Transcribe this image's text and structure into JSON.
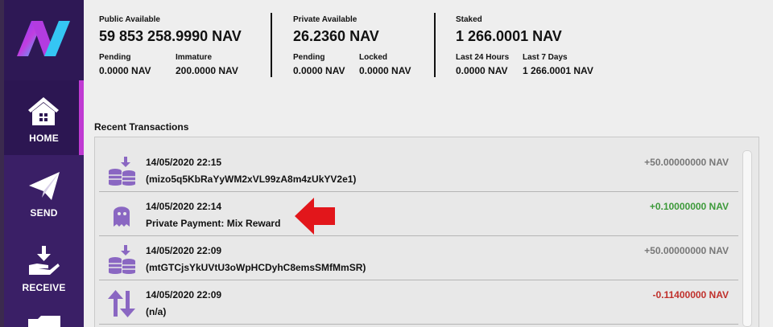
{
  "sidebar": {
    "items": [
      {
        "label": "HOME",
        "icon": "home-icon",
        "active": true
      },
      {
        "label": "SEND",
        "icon": "send-icon",
        "active": false
      },
      {
        "label": "RECEIVE",
        "icon": "receive-icon",
        "active": false
      }
    ]
  },
  "balances": {
    "public": {
      "title": "Public Available",
      "value": "59 853 258.9990 NAV",
      "pending_label": "Pending",
      "pending_value": "0.0000 NAV",
      "immature_label": "Immature",
      "immature_value": "200.0000 NAV"
    },
    "private": {
      "title": "Private Available",
      "value": "26.2360 NAV",
      "pending_label": "Pending",
      "pending_value": "0.0000 NAV",
      "locked_label": "Locked",
      "locked_value": "0.0000 NAV"
    },
    "staked": {
      "title": "Staked",
      "value": "1 266.0001 NAV",
      "last24_label": "Last 24 Hours",
      "last24_value": "0.0000 NAV",
      "last7_label": "Last 7 Days",
      "last7_value": "1 266.0001 NAV"
    }
  },
  "transactions": {
    "title": "Recent Transactions",
    "rows": [
      {
        "date": "14/05/2020 22:15",
        "desc": "(mizo5q5KbRaYyWM2xVL99zA8m4zUkYV2e1)",
        "amount": "+50.00000000 NAV",
        "icon": "stake-coins-icon"
      },
      {
        "date": "14/05/2020 22:14",
        "desc": "Private Payment: Mix Reward",
        "amount": "+0.10000000 NAV",
        "icon": "ghost-icon"
      },
      {
        "date": "14/05/2020 22:09",
        "desc": "(mtGTCjsYkUVtU3oWpHCDyhC8emsSMfMmSR)",
        "amount": "+50.00000000 NAV",
        "icon": "stake-coins-icon"
      },
      {
        "date": "14/05/2020 22:09",
        "desc": "(n/a)",
        "amount": "-0.11400000 NAV",
        "icon": "transfer-arrows-icon"
      }
    ]
  },
  "colors": {
    "sidebar": "#3a1f66",
    "accent": "#c03ad3",
    "amount_neutral": "#777777",
    "amount_positive": "#3d9a3a",
    "amount_negative": "#c0302b",
    "icon_purple": "#8a67c2",
    "annotation_arrow": "#e2161b"
  }
}
